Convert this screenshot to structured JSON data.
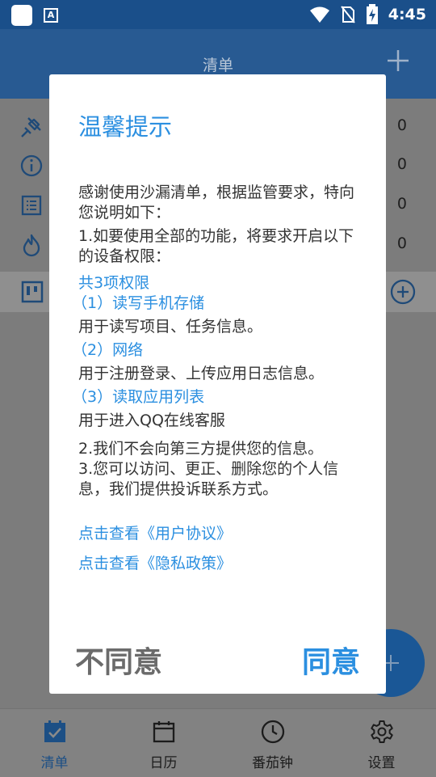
{
  "status_bar": {
    "time": "4:45",
    "icons": [
      "app-square-icon",
      "a-text-icon",
      "wifi-icon",
      "no-sim-icon",
      "battery-charging-icon"
    ]
  },
  "app_bar": {
    "title": "清单",
    "add_icon": "plus-icon"
  },
  "list": {
    "rows": [
      {
        "icon": "pin-icon",
        "count": "0"
      },
      {
        "icon": "info-icon",
        "count": "0"
      },
      {
        "icon": "list-icon",
        "count": "0"
      },
      {
        "icon": "fire-icon",
        "count": "0"
      }
    ],
    "group_icon": "board-icon",
    "group_add_icon": "circle-plus-icon"
  },
  "bottom_nav": {
    "items": [
      {
        "label": "清单",
        "icon": "checklist-icon",
        "active": true
      },
      {
        "label": "日历",
        "icon": "calendar-icon",
        "active": false
      },
      {
        "label": "番茄钟",
        "icon": "clock-icon",
        "active": false
      },
      {
        "label": "设置",
        "icon": "gear-icon",
        "active": false
      }
    ]
  },
  "dialog": {
    "title": "温馨提示",
    "intro": "感谢使用沙漏清单，根据监管要求，特向您说明如下：",
    "point1": "1.如要使用全部的功能，将要求开启以下的设备权限：",
    "perm_count": "共3项权限",
    "perm1_title": "（1）读写手机存储",
    "perm1_desc": "用于读写项目、任务信息。",
    "perm2_title": "（2）网络",
    "perm2_desc": "用于注册登录、上传应用日志信息。",
    "perm3_title": "（3）读取应用列表",
    "perm3_desc": "用于进入QQ在线客服",
    "point2": "2.我们不会向第三方提供您的信息。",
    "point3": "3.您可以访问、更正、删除您的个人信息，我们提供投诉联系方式。",
    "link_agreement": "点击查看《用户协议》",
    "link_privacy": "点击查看《隐私政策》",
    "decline_label": "不同意",
    "agree_label": "同意"
  },
  "colors": {
    "accent": "#2b8fe0",
    "status_bar": "#1a4f8a",
    "app_bar": "#285a92",
    "decline_text": "#6b6b6b"
  }
}
